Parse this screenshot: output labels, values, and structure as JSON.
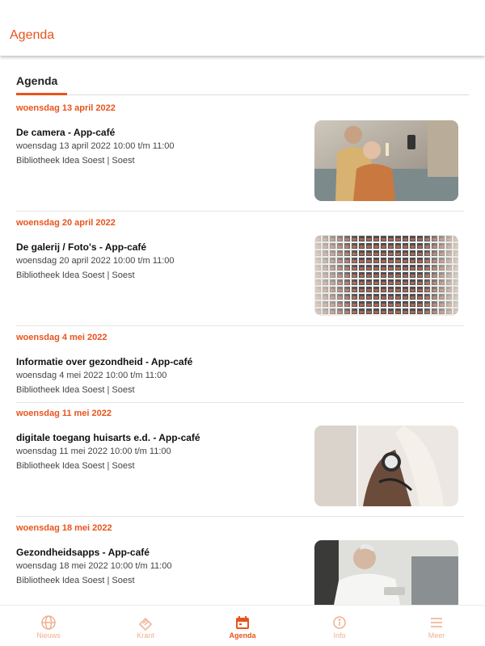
{
  "appbar": {
    "title": "Agenda"
  },
  "section": {
    "tab_label": "Agenda"
  },
  "events": [
    {
      "date": "woensdag 13 april 2022",
      "title": "De camera - App-café",
      "time": "woensdag 13 april 2022 10:00 t/m 11:00",
      "location": "Bibliotheek Idea Soest | Soest",
      "image": "seniors-selfie-photo"
    },
    {
      "date": "woensdag 20 april 2022",
      "title": "De galerij / Foto's - App-café",
      "time": "woensdag 20 april 2022 10:00 t/m 11:00",
      "location": "Bibliotheek Idea Soest | Soest",
      "image": "photo-wall-photo"
    },
    {
      "date": "woensdag 4 mei 2022",
      "title": "Informatie over gezondheid - App-café",
      "time": "woensdag 4 mei 2022 10:00 t/m 11:00",
      "location": "Bibliotheek Idea Soest | Soest",
      "image": ""
    },
    {
      "date": "woensdag 11 mei 2022",
      "title": "digitale toegang huisarts e.d. - App-café",
      "time": "woensdag 11 mei 2022 10:00 t/m 11:00",
      "location": "Bibliotheek Idea Soest | Soest",
      "image": "blood-pressure-photo"
    },
    {
      "date": "woensdag 18 mei 2022",
      "title": "Gezondheidsapps - App-café",
      "time": "woensdag 18 mei 2022 10:00 t/m 11:00",
      "location": "Bibliotheek Idea Soest | Soest",
      "image": "senior-man-photo"
    }
  ],
  "bottom_nav": [
    {
      "label": "Nieuws",
      "icon": "globe-icon",
      "active": false
    },
    {
      "label": "Krant",
      "icon": "newspaper-icon",
      "active": false
    },
    {
      "label": "Agenda",
      "icon": "calendar-icon",
      "active": true
    },
    {
      "label": "Info",
      "icon": "info-icon",
      "active": false
    },
    {
      "label": "Meer",
      "icon": "menu-icon",
      "active": false
    }
  ],
  "colors": {
    "accent": "#e8541c",
    "accent_muted": "#f0b08f",
    "divider": "#e3e3e3"
  }
}
